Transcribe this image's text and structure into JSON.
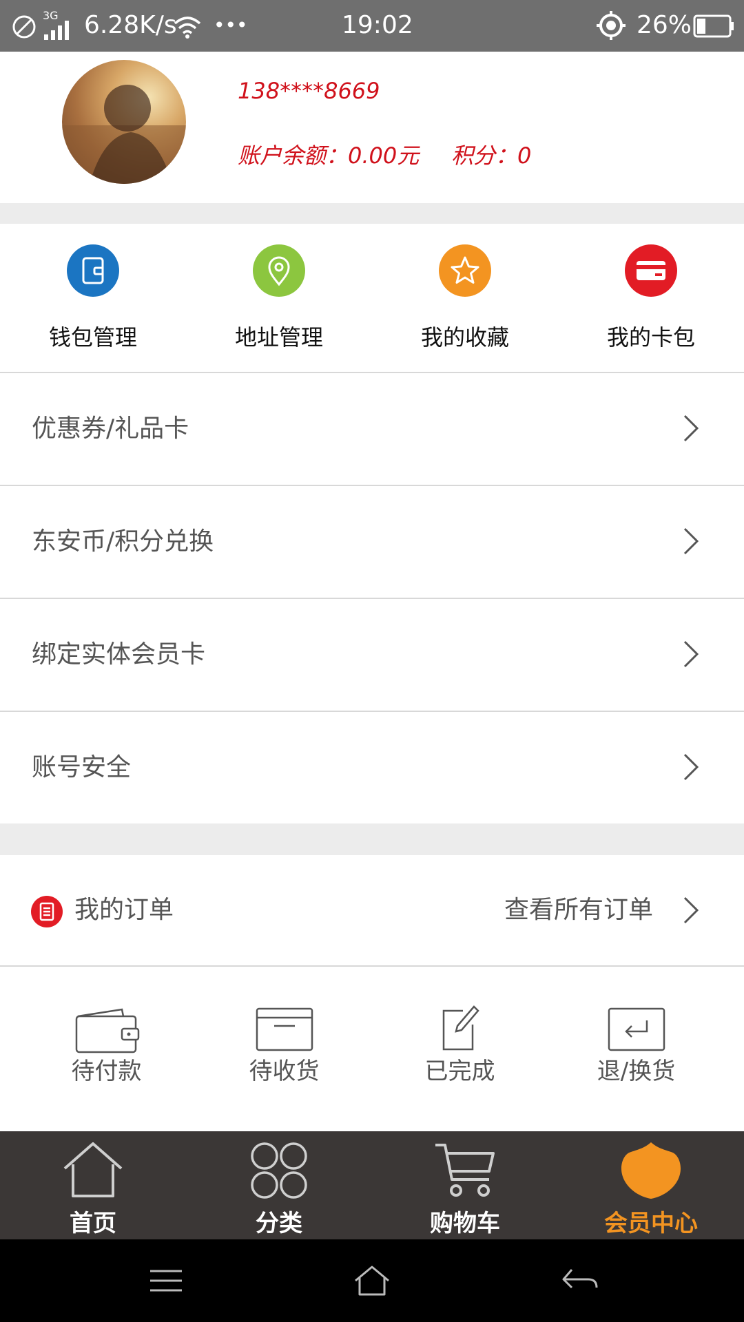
{
  "status_bar": {
    "network": "3G",
    "speed": "6.28K/s",
    "more": "•••",
    "time": "19:02",
    "battery": "26%"
  },
  "profile": {
    "phone": "138****8669",
    "balance_text": "账户余额：0.00元",
    "points_text": "积分：0"
  },
  "quick_actions": [
    {
      "label": "钱包管理",
      "icon": "wallet-icon",
      "color": "#1b75c2"
    },
    {
      "label": "地址管理",
      "icon": "location-pin-icon",
      "color": "#8cc63f"
    },
    {
      "label": "我的收藏",
      "icon": "star-icon",
      "color": "#f39421"
    },
    {
      "label": "我的卡包",
      "icon": "card-icon",
      "color": "#e21c25"
    }
  ],
  "menu": [
    {
      "label": "优惠券/礼品卡"
    },
    {
      "label": "东安币/积分兑换"
    },
    {
      "label": "绑定实体会员卡"
    },
    {
      "label": "账号安全"
    }
  ],
  "orders": {
    "title": "我的订单",
    "view_all": "查看所有订单",
    "items": [
      {
        "label": "待付款",
        "icon": "wallet-outline-icon"
      },
      {
        "label": "待收货",
        "icon": "box-icon"
      },
      {
        "label": "已完成",
        "icon": "edit-icon"
      },
      {
        "label": "退/换货",
        "icon": "return-icon"
      }
    ]
  },
  "bottom_nav": [
    {
      "label": "首页",
      "icon": "home-icon",
      "active": false
    },
    {
      "label": "分类",
      "icon": "category-icon",
      "active": false
    },
    {
      "label": "购物车",
      "icon": "cart-icon",
      "active": false
    },
    {
      "label": "会员中心",
      "icon": "member-icon",
      "active": true
    }
  ],
  "colors": {
    "accent": "#f39421",
    "red": "#d0111b",
    "nav_bg": "#3b3736",
    "status_bg": "#6f6f6f"
  }
}
